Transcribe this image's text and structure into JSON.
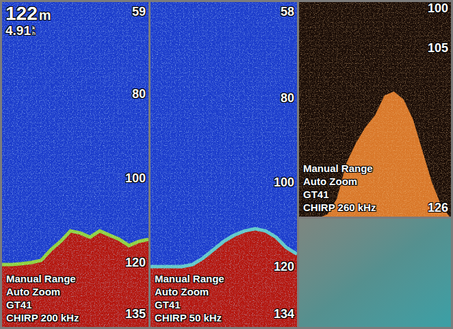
{
  "panels": [
    {
      "kind": "sonar",
      "header": {
        "depth": "122",
        "depth_unit": "m",
        "speed": "4.91",
        "speed_unit_top": "k",
        "speed_unit_bottom": "h"
      },
      "ticks": [
        "59",
        "80",
        "100",
        "120",
        "135"
      ],
      "labels": [
        "Manual Range",
        "Auto Zoom",
        "GT41",
        "CHIRP 200 kHz"
      ],
      "color": "#8fd23a",
      "bottom_depths": [
        120.5,
        120.5,
        120.3,
        120,
        119.5,
        117,
        115,
        112.5,
        113,
        114,
        112.5,
        113.5,
        114.5,
        116,
        115,
        114.5
      ]
    },
    {
      "kind": "sonar",
      "ticks": [
        "58",
        "80",
        "100",
        "120",
        "134"
      ],
      "labels": [
        "Manual Range",
        "Auto Zoom",
        "GT41",
        "CHIRP 50 kHz"
      ],
      "color": "#5fc8c8",
      "bottom_depths": [
        120,
        120,
        120,
        120,
        119.5,
        118,
        116,
        114,
        112.5,
        111.5,
        111,
        111.5,
        113,
        115.5,
        117
      ]
    },
    {
      "kind": "zoom",
      "ticks": [
        "100",
        "105",
        "126"
      ],
      "labels": [
        "Manual Range",
        "Auto Zoom",
        "GT41",
        "CHIRP 260 kHz"
      ],
      "color": "#d9782a",
      "bottom_depths": [
        126.5,
        126.5,
        126.5,
        126,
        124,
        119.5,
        117,
        115,
        113.5,
        111,
        110.5,
        111.5,
        114,
        118,
        122,
        125,
        126.5
      ]
    }
  ]
}
